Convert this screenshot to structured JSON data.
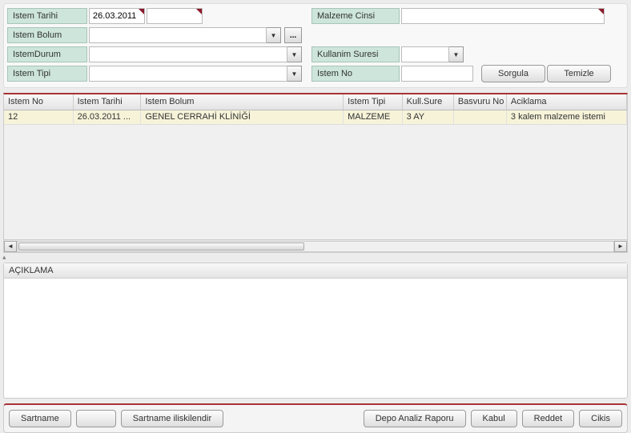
{
  "filters": {
    "left": {
      "istem_tarihi_label": "Istem Tarihi",
      "istem_tarihi_from": "26.03.2011",
      "istem_tarihi_to": "",
      "istem_bolum_label": "Istem Bolum",
      "istem_bolum_value": "",
      "istem_durum_label": "IstemDurum",
      "istem_durum_value": "",
      "istem_tipi_label": "Istem Tipi",
      "istem_tipi_value": ""
    },
    "right": {
      "malzeme_cinsi_label": "Malzeme Cinsi",
      "malzeme_cinsi_value": "",
      "kullanim_suresi_label": "Kullanim Suresi",
      "kullanim_suresi_value": "",
      "istem_no_label": "Istem No",
      "istem_no_value": "",
      "sorgula_label": "Sorgula",
      "temizle_label": "Temizle"
    }
  },
  "grid": {
    "headers": {
      "istem_no": "Istem No",
      "istem_tarihi": "Istem Tarihi",
      "istem_bolum": "Istem Bolum",
      "istem_tipi": "Istem Tipi",
      "kull_sure": "Kull.Sure",
      "basvuru_no": "Basvuru No",
      "aciklama": "Aciklama"
    },
    "rows": [
      {
        "istem_no": "12",
        "istem_tarihi": "26.03.2011 ...",
        "istem_bolum": "GENEL CERRAHİ KLİNİĞİ",
        "istem_tipi": "MALZEME",
        "kull_sure": "3 AY",
        "basvuru_no": "",
        "aciklama": "3 kalem malzeme istemi"
      }
    ]
  },
  "detail": {
    "aciklama_header": "AÇIKLAMA"
  },
  "buttons": {
    "sartname": "Sartname",
    "empty": "",
    "sartname_iliskilendir": "Sartname iliskilendir",
    "depo_analiz": "Depo Analiz Raporu",
    "kabul": "Kabul",
    "reddet": "Reddet",
    "cikis": "Cikis"
  }
}
